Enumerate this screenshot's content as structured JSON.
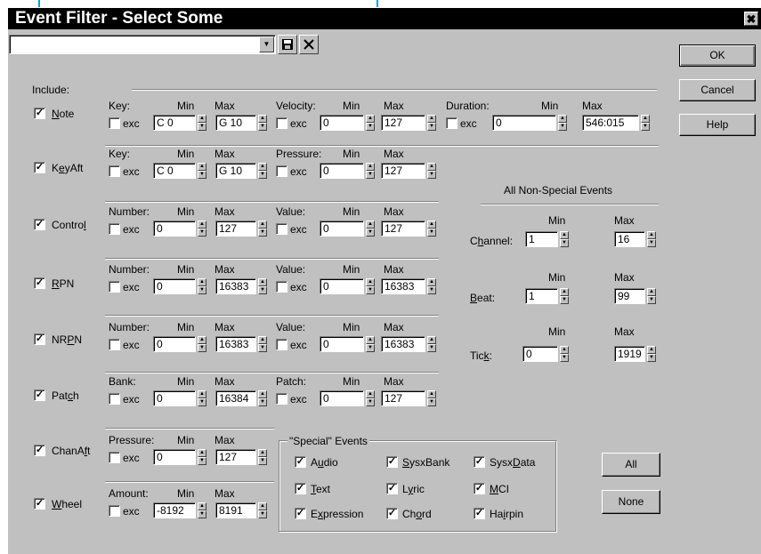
{
  "window": {
    "title": "Event Filter - Select Some",
    "close_glyph": "✖"
  },
  "toolbar": {
    "preset_value": "",
    "save_icon": "floppy-disk-icon",
    "delete_icon": "x-icon"
  },
  "buttons": {
    "ok": "OK",
    "cancel": "Cancel",
    "help": "Help",
    "all": "All",
    "none": "None"
  },
  "include_label": "Include:",
  "exc_label": "exc",
  "min_label": "Min",
  "max_label": "Max",
  "event_types": [
    {
      "pre": "",
      "acc": "N",
      "post": "ote",
      "checked": true
    },
    {
      "pre": "K",
      "acc": "e",
      "post": "yAft",
      "checked": true
    },
    {
      "pre": "Contro",
      "acc": "l",
      "post": "",
      "checked": true
    },
    {
      "pre": "",
      "acc": "R",
      "post": "PN",
      "checked": true
    },
    {
      "pre": "NR",
      "acc": "P",
      "post": "N",
      "checked": true
    },
    {
      "pre": "Pat",
      "acc": "c",
      "post": "h",
      "checked": true
    },
    {
      "pre": "ChanA",
      "acc": "f",
      "post": "t",
      "checked": true
    },
    {
      "pre": "",
      "acc": "W",
      "post": "heel",
      "checked": true
    }
  ],
  "note": {
    "key": {
      "label": "Key:",
      "min": "C 0",
      "max": "G 10"
    },
    "velocity": {
      "label": "Velocity:",
      "min": "0",
      "max": "127"
    },
    "duration": {
      "label": "Duration:",
      "min": "0",
      "max": "546:015"
    }
  },
  "keyaft": {
    "key": {
      "label": "Key:",
      "min": "C 0",
      "max": "G 10"
    },
    "pressure": {
      "label": "Pressure:",
      "min": "0",
      "max": "127"
    }
  },
  "control": {
    "number": {
      "label": "Number:",
      "min": "0",
      "max": "127"
    },
    "value": {
      "label": "Value:",
      "min": "0",
      "max": "127"
    }
  },
  "rpn": {
    "number": {
      "label": "Number:",
      "min": "0",
      "max": "16383"
    },
    "value": {
      "label": "Value:",
      "min": "0",
      "max": "16383"
    }
  },
  "nrpn": {
    "number": {
      "label": "Number:",
      "min": "0",
      "max": "16383"
    },
    "value": {
      "label": "Value:",
      "min": "0",
      "max": "16383"
    }
  },
  "patch": {
    "bank": {
      "label": "Bank:",
      "min": "0",
      "max": "16384"
    },
    "patch": {
      "label": "Patch:",
      "min": "0",
      "max": "127"
    }
  },
  "chanaft": {
    "pressure": {
      "label": "Pressure:",
      "min": "0",
      "max": "127"
    }
  },
  "wheel": {
    "amount": {
      "label": "Amount:",
      "min": "-8192",
      "max": "8191"
    }
  },
  "non_special": {
    "title": "All Non-Special Events",
    "channel": {
      "pre": "C",
      "acc": "h",
      "post": "annel:",
      "min": "1",
      "max": "16"
    },
    "beat": {
      "pre": "",
      "acc": "B",
      "post": "eat:",
      "min": "1",
      "max": "99"
    },
    "tick": {
      "pre": "Tic",
      "acc": "k",
      "post": ":",
      "min": "0",
      "max": "1919"
    }
  },
  "special": {
    "title": "\"Special\" Events",
    "items": [
      {
        "pre": "A",
        "acc": "u",
        "post": "dio",
        "checked": true
      },
      {
        "pre": "",
        "acc": "S",
        "post": "ysxBank",
        "checked": true
      },
      {
        "pre": "Sysx",
        "acc": "D",
        "post": "ata",
        "checked": true
      },
      {
        "pre": "",
        "acc": "T",
        "post": "ext",
        "checked": true
      },
      {
        "pre": "L",
        "acc": "y",
        "post": "ric",
        "checked": true
      },
      {
        "pre": "",
        "acc": "M",
        "post": "CI",
        "checked": true
      },
      {
        "pre": "E",
        "acc": "x",
        "post": "pression",
        "checked": true
      },
      {
        "pre": "Ch",
        "acc": "o",
        "post": "rd",
        "checked": true
      },
      {
        "pre": "Ha",
        "acc": "i",
        "post": "rpin",
        "checked": true
      }
    ]
  },
  "colors": {
    "callout": "#00a0e0",
    "dialog_bg": "#c0c0c0",
    "titlebar": "#000000"
  }
}
